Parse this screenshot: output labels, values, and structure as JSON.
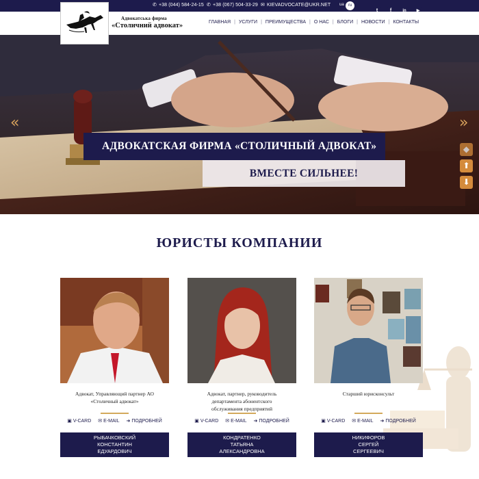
{
  "topbar": {
    "phone1": "+38 (044) 584-24-15",
    "phone2": "+38 (067) 504-33-29",
    "email": "KIEVADVOCATE@UKR.NET",
    "lang_ua": "ua",
    "lang_ru": "ru",
    "social": [
      "t",
      "f",
      "in",
      "▶"
    ]
  },
  "brand": {
    "small": "Адвокатська фирма",
    "big": "«Столичний адвокат»"
  },
  "nav": [
    "ГЛАВНАЯ",
    "УСЛУГИ",
    "ПРЕИМУЩЕСТВА",
    "О НАС",
    "БЛОГИ",
    "НОВОСТИ",
    "КОНТАКТЫ"
  ],
  "hero": {
    "banner_title": "АДВОКАТСКАЯ ФИРМА «СТОЛИЧНЫЙ АДВОКАТ»",
    "banner_subtitle": "ВМЕСТЕ СИЛЬНЕЕ!",
    "prev_arrow": "«",
    "next_arrow": "»"
  },
  "section": {
    "title": "ЮРИСТЫ КОМПАНИИ"
  },
  "lawyers": [
    {
      "role_lines": [
        "Адвокат, Управляющий партнер АО",
        "«Столичный адвокат»"
      ],
      "vcard": "V-CARD",
      "email": "E-MAIL",
      "more": "ПОДРОБНЕЙ",
      "name_lines": [
        "РЫБАЧКОВСКИЙ",
        "КОНСТАНТИН",
        "ЕДУАРДОВИЧ"
      ]
    },
    {
      "role_lines": [
        "Адвокат, партнер, руководитель",
        "департамента абонентского",
        "обслуживания предприятий"
      ],
      "vcard": "V-CARD",
      "email": "E-MAIL",
      "more": "ПОДРОБНЕЙ",
      "name_lines": [
        "КОНДРАТЕНКО",
        "ТАТЬЯНА",
        "АЛЕКСАНДРОВНА"
      ]
    },
    {
      "role_lines": [
        "Старший юрисконсульт"
      ],
      "vcard": "V-CARD",
      "email": "E-MAIL",
      "more": "ПОДРОБНЕЙ",
      "name_lines": [
        "НИКИФОРОВ",
        "СЕРГЕЙ",
        "СЕРГЕЕВИЧ"
      ]
    }
  ],
  "colors": {
    "navy": "#1d1b4c",
    "accent": "#d48b3c",
    "gold_rule": "#d3a95b"
  },
  "icons": {
    "phone": "phone-icon",
    "email": "envelope-icon",
    "vcard": "vcard-icon",
    "more": "arrow-right-icon"
  }
}
